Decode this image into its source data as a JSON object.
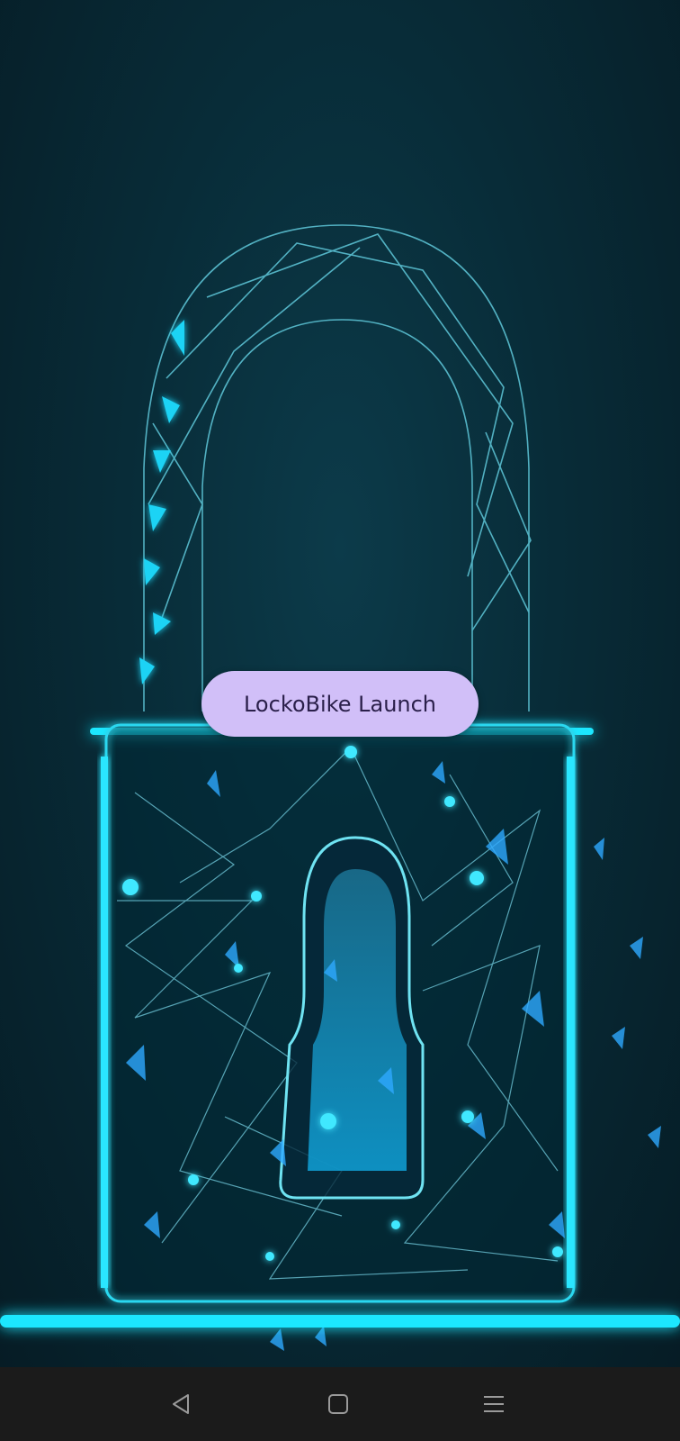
{
  "app": {
    "launch_button_label": "LockoBike Launch"
  },
  "background": {
    "image_subject": "padlock-illustration",
    "colors": {
      "base": "#061c25",
      "glow": "#15e4ff",
      "lines": "#5fd3e6",
      "accent": "#2a8cff"
    }
  },
  "navigation_bar": {
    "background_color": "#1b1b1b",
    "icon_color": "#9a9a9a",
    "buttons": [
      {
        "name": "back",
        "icon": "triangle-left-icon"
      },
      {
        "name": "home",
        "icon": "rounded-square-icon"
      },
      {
        "name": "menu",
        "icon": "three-lines-icon"
      }
    ]
  }
}
